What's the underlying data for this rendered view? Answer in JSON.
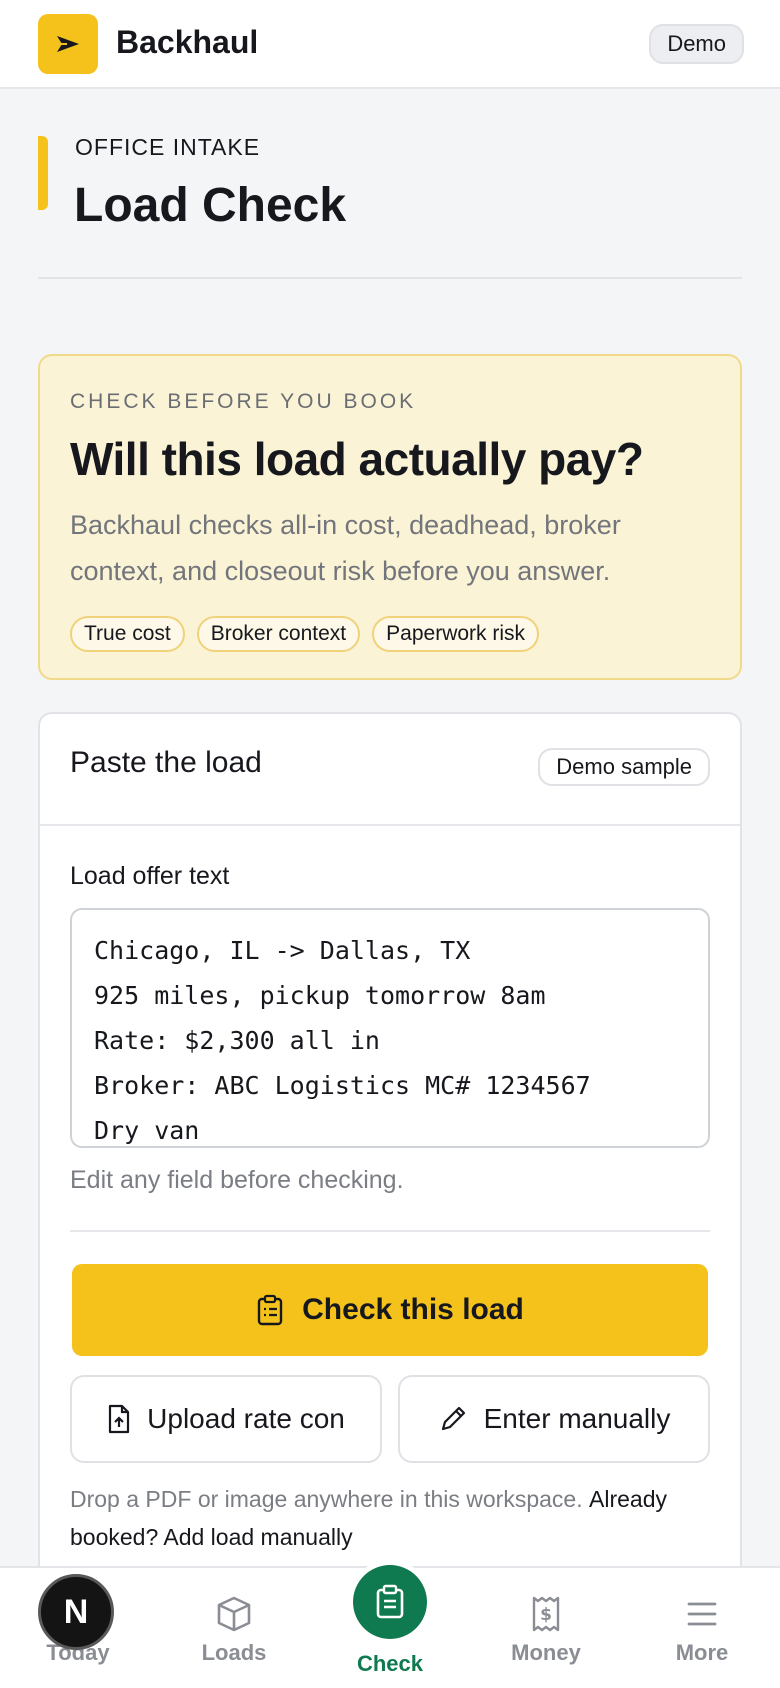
{
  "header": {
    "brand": "Backhaul",
    "demo_badge": "Demo",
    "logo_icon": "arrow-plane-icon",
    "accent_color": "#f5c21b"
  },
  "page": {
    "eyebrow": "OFFICE INTAKE",
    "title": "Load Check"
  },
  "hero": {
    "kicker": "CHECK BEFORE YOU BOOK",
    "title": "Will this load actually pay?",
    "body": "Backhaul checks all-in cost, deadhead, broker context, and closeout risk before you answer.",
    "chips": [
      "True cost",
      "Broker context",
      "Paperwork risk"
    ]
  },
  "form": {
    "title": "Paste the load",
    "sample_button": "Demo sample",
    "field_label": "Load offer text",
    "field_value": "Chicago, IL -> Dallas, TX\n925 miles, pickup tomorrow 8am\nRate: $2,300 all in\nBroker: ABC Logistics MC# 1234567\nDry van",
    "hint": "Edit any field before checking.",
    "primary_button": "Check this load",
    "upload_button": "Upload rate con",
    "manual_button": "Enter manually",
    "footnote_text": "Drop a PDF or image anywhere in this workspace.",
    "footnote_link": "Already booked? Add load manually"
  },
  "nav": {
    "items": [
      {
        "label": "Today",
        "icon": "sun-icon"
      },
      {
        "label": "Loads",
        "icon": "box-icon"
      },
      {
        "label": "Check",
        "icon": "clipboard-icon",
        "active": true
      },
      {
        "label": "Money",
        "icon": "receipt-dollar-icon"
      },
      {
        "label": "More",
        "icon": "menu-icon"
      }
    ],
    "avatar_letter": "N",
    "active_color": "#0f7a4f"
  }
}
